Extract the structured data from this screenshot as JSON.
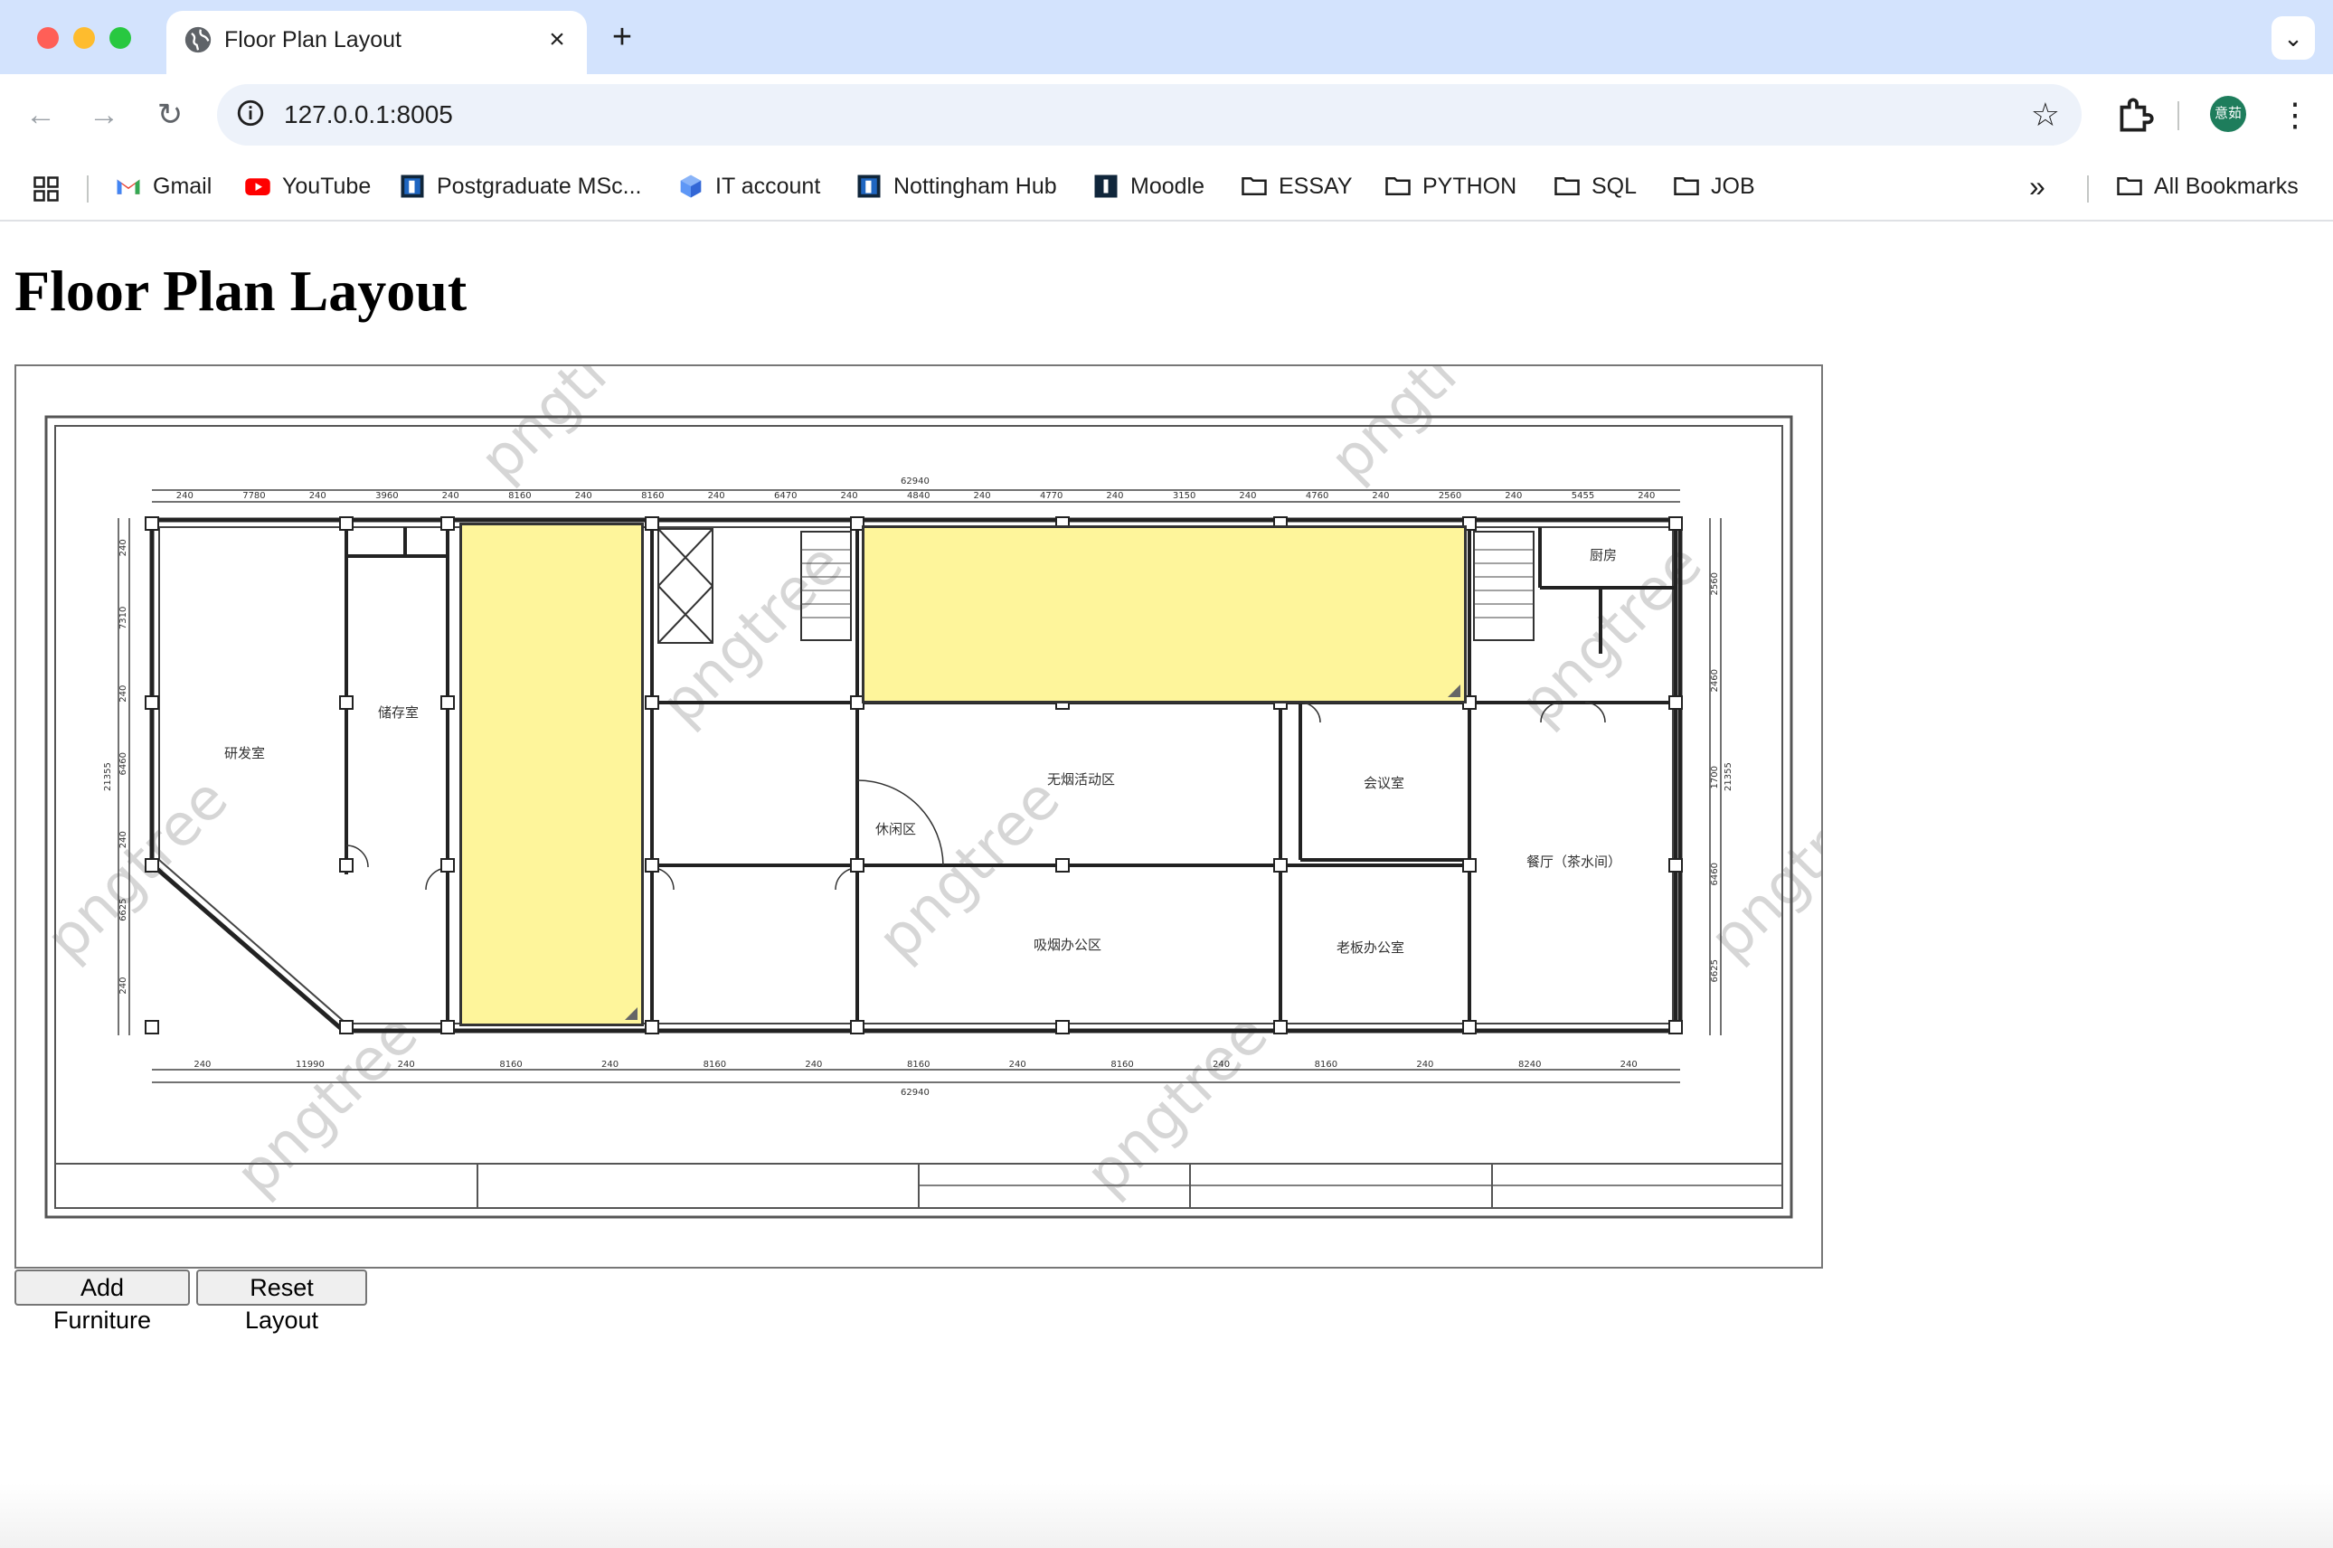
{
  "browser": {
    "tab_title": "Floor Plan Layout",
    "url": "127.0.0.1:8005",
    "avatar_text": "意茹",
    "colors": {
      "tabstrip": "#d3e3fd",
      "omnibox": "#edf2fa",
      "close_dot": "#ff5f57",
      "min_dot": "#febc2e",
      "max_dot": "#28c840"
    },
    "bookmarks": [
      {
        "label": "Gmail",
        "icon": "gmail-icon"
      },
      {
        "label": "YouTube",
        "icon": "youtube-icon"
      },
      {
        "label": "Postgraduate MSc...",
        "icon": "nottingham-icon"
      },
      {
        "label": "IT account",
        "icon": "cube-icon"
      },
      {
        "label": "Nottingham Hub",
        "icon": "nottingham-icon"
      },
      {
        "label": "Moodle",
        "icon": "moodle-icon"
      },
      {
        "label": "ESSAY",
        "icon": "folder-icon"
      },
      {
        "label": "PYTHON",
        "icon": "folder-icon"
      },
      {
        "label": "SQL",
        "icon": "folder-icon"
      },
      {
        "label": "JOB",
        "icon": "folder-icon"
      }
    ],
    "all_bookmarks": "All Bookmarks"
  },
  "page": {
    "title": "Floor Plan Layout",
    "buttons": {
      "add": "Add Furniture",
      "reset": "Reset Layout"
    },
    "furniture_color": "#fef59b"
  },
  "floor_plan": {
    "watermark": "pngtree",
    "total_dimension": "62940",
    "side_dimension": "21355",
    "rooms": [
      "研发室",
      "储存室",
      "无烟活动区",
      "休闲区",
      "会议室",
      "厨房",
      "餐厅（茶水间）",
      "吸烟办公区",
      "老板办公室"
    ],
    "top_dims": [
      "240",
      "7780",
      "240",
      "3960",
      "240",
      "8160",
      "240",
      "8160",
      "240",
      "6470",
      "240",
      "4840",
      "240",
      "4770",
      "240",
      "3150",
      "240",
      "4760",
      "240",
      "2560",
      "240",
      "5455",
      "240"
    ],
    "bottom_dims": [
      "240",
      "11990",
      "240",
      "8160",
      "240",
      "8160",
      "240",
      "8160",
      "240",
      "8160",
      "240",
      "8160",
      "240",
      "8240",
      "240"
    ],
    "left_dims": [
      "240",
      "7310",
      "240",
      "6460",
      "240",
      "6625",
      "240"
    ],
    "right_dims": [
      "2560",
      "2460",
      "1700",
      "6460",
      "6625"
    ]
  }
}
